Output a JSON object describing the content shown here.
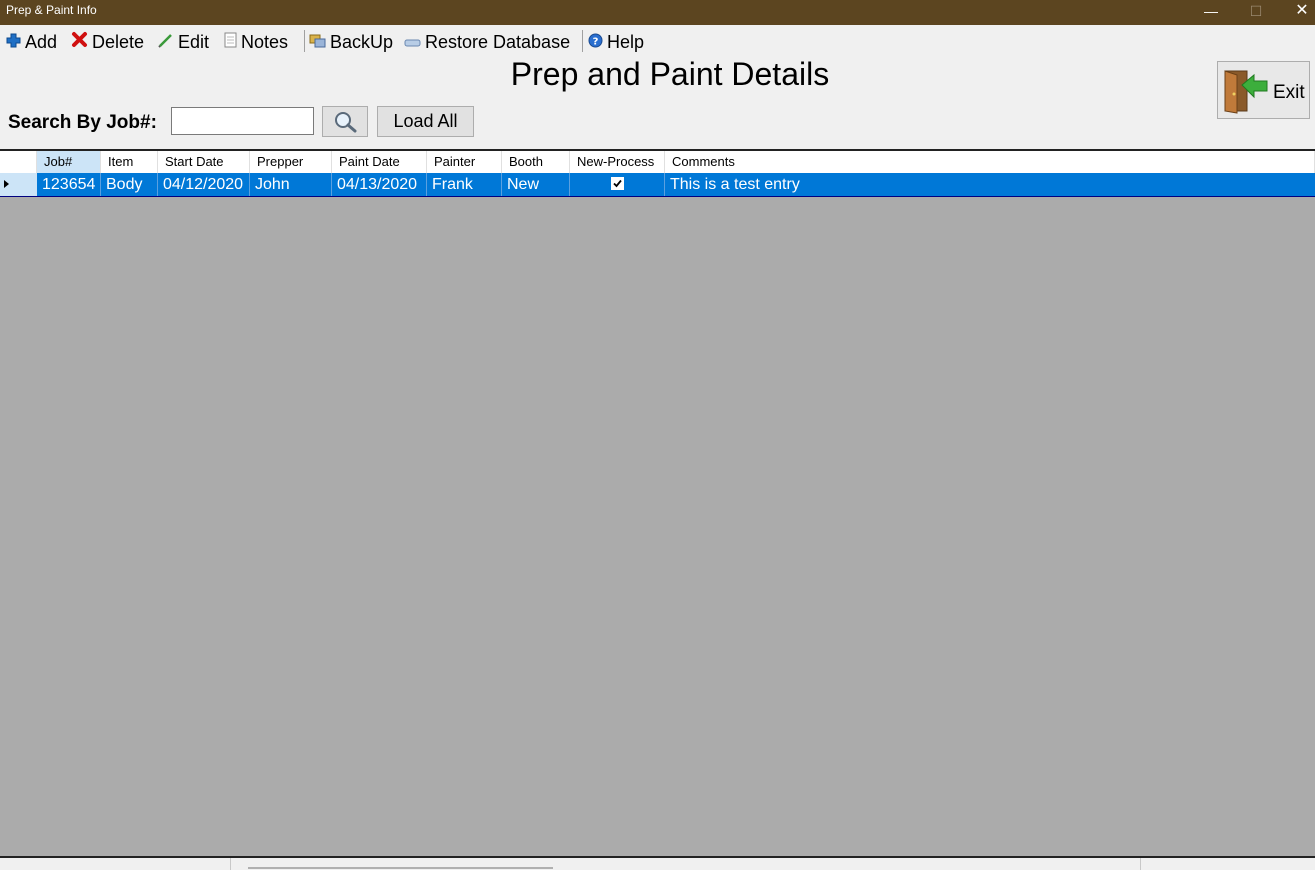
{
  "window": {
    "title": "Prep & Paint Info",
    "minimize_glyph": "—",
    "maximize_glyph": "☐",
    "close_glyph": "✕"
  },
  "menu": {
    "add": "Add",
    "delete": "Delete",
    "edit": "Edit",
    "notes": "Notes",
    "backup": "BackUp",
    "restore": "Restore Database",
    "help": "Help"
  },
  "page": {
    "title": "Prep and Paint Details"
  },
  "exit_button": {
    "label": "Exit"
  },
  "search": {
    "label": "Search By Job#:",
    "value": "",
    "load_all_label": "Load All"
  },
  "grid": {
    "columns": [
      "Job#",
      "Item",
      "Start Date",
      "Prepper",
      "Paint Date",
      "Painter",
      "Booth",
      "New-Process",
      "Comments"
    ],
    "rows": [
      {
        "job": "123654",
        "item": "Body",
        "start_date": "04/12/2020",
        "prepper": "John",
        "paint_date": "04/13/2020",
        "painter": "Frank",
        "booth": "New",
        "new_process": true,
        "comments": "This is a test entry"
      }
    ],
    "selected_row": 0
  },
  "colors": {
    "titlebar": "#5c4520",
    "selection": "#0078d7",
    "grid_background": "#ababab",
    "active_header": "#cce4f7"
  },
  "icons": {
    "add": "plus-icon",
    "delete": "x-icon",
    "edit": "pencil-icon",
    "notes": "document-icon",
    "backup": "backup-icon",
    "restore": "restore-icon",
    "help": "help-icon",
    "search": "magnifier-icon",
    "exit": "exit-door-icon"
  }
}
